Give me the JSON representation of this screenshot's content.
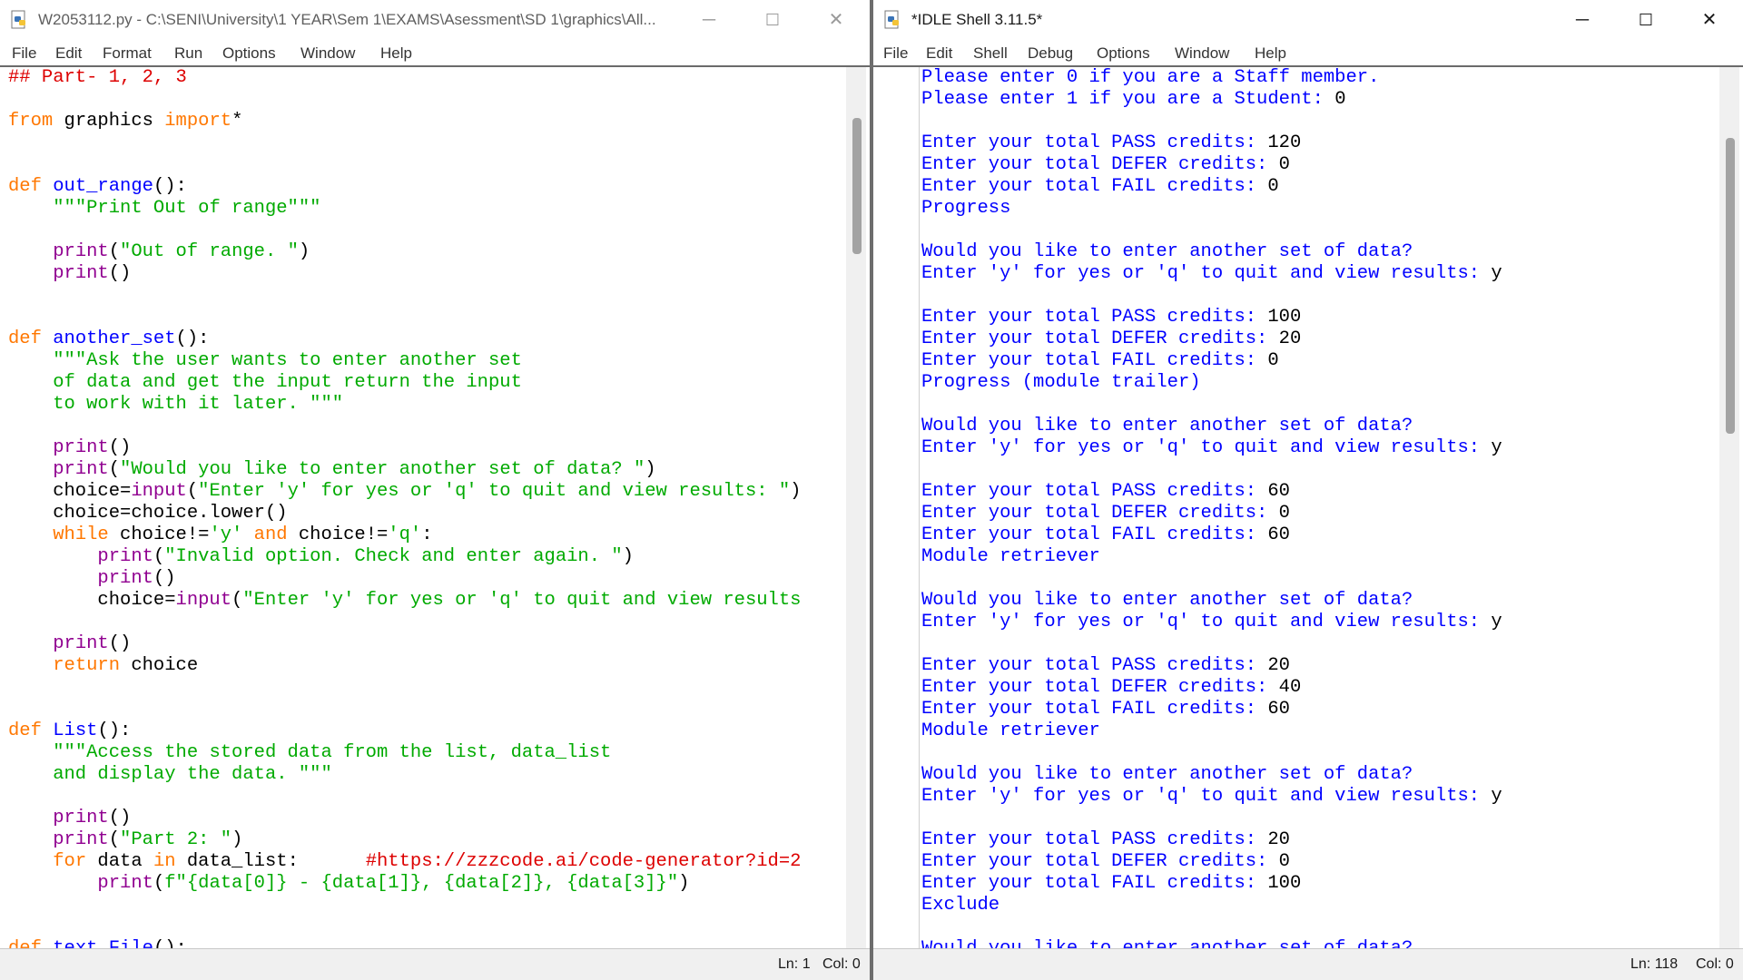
{
  "editor": {
    "title": "W2053112.py - C:\\SENI\\University\\1 YEAR\\Sem 1\\EXAMS\\Asessment\\SD 1\\graphics\\All...",
    "menu": [
      "File",
      "Edit",
      "Format",
      "Run",
      "Options",
      "Window",
      "Help"
    ],
    "status_ln": "Ln: 1",
    "status_col": "Col: 0",
    "code": [
      [
        [
          "c",
          "## Part- 1, 2, 3"
        ]
      ],
      [],
      [
        [
          "k",
          "from"
        ],
        [
          "n",
          " graphics "
        ],
        [
          "k",
          "import"
        ],
        [
          "n",
          "*"
        ]
      ],
      [],
      [],
      [
        [
          "k",
          "def"
        ],
        [
          "n",
          " "
        ],
        [
          "d",
          "out_range"
        ],
        [
          "n",
          "():"
        ]
      ],
      [
        [
          "n",
          "    "
        ],
        [
          "s",
          "\"\"\"Print Out of range\"\"\""
        ]
      ],
      [],
      [
        [
          "n",
          "    "
        ],
        [
          "b",
          "print"
        ],
        [
          "n",
          "("
        ],
        [
          "s",
          "\"Out of range. \""
        ],
        [
          "n",
          ")"
        ]
      ],
      [
        [
          "n",
          "    "
        ],
        [
          "b",
          "print"
        ],
        [
          "n",
          "()"
        ]
      ],
      [],
      [],
      [
        [
          "k",
          "def"
        ],
        [
          "n",
          " "
        ],
        [
          "d",
          "another_set"
        ],
        [
          "n",
          "():"
        ]
      ],
      [
        [
          "n",
          "    "
        ],
        [
          "s",
          "\"\"\"Ask the user wants to enter another set"
        ]
      ],
      [
        [
          "s",
          "    of data and get the input return the input"
        ]
      ],
      [
        [
          "s",
          "    to work with it later. \"\"\""
        ]
      ],
      [],
      [
        [
          "n",
          "    "
        ],
        [
          "b",
          "print"
        ],
        [
          "n",
          "()"
        ]
      ],
      [
        [
          "n",
          "    "
        ],
        [
          "b",
          "print"
        ],
        [
          "n",
          "("
        ],
        [
          "s",
          "\"Would you like to enter another set of data? \""
        ],
        [
          "n",
          ")"
        ]
      ],
      [
        [
          "n",
          "    choice="
        ],
        [
          "b",
          "input"
        ],
        [
          "n",
          "("
        ],
        [
          "s",
          "\"Enter 'y' for yes or 'q' to quit and view results: \""
        ],
        [
          "n",
          ")"
        ]
      ],
      [
        [
          "n",
          "    choice=choice.lower()"
        ]
      ],
      [
        [
          "n",
          "    "
        ],
        [
          "k",
          "while"
        ],
        [
          "n",
          " choice!="
        ],
        [
          "s",
          "'y'"
        ],
        [
          "n",
          " "
        ],
        [
          "k",
          "and"
        ],
        [
          "n",
          " choice!="
        ],
        [
          "s",
          "'q'"
        ],
        [
          "n",
          ":"
        ]
      ],
      [
        [
          "n",
          "        "
        ],
        [
          "b",
          "print"
        ],
        [
          "n",
          "("
        ],
        [
          "s",
          "\"Invalid option. Check and enter again. \""
        ],
        [
          "n",
          ")"
        ]
      ],
      [
        [
          "n",
          "        "
        ],
        [
          "b",
          "print"
        ],
        [
          "n",
          "()"
        ]
      ],
      [
        [
          "n",
          "        choice="
        ],
        [
          "b",
          "input"
        ],
        [
          "n",
          "("
        ],
        [
          "s",
          "\"Enter 'y' for yes or 'q' to quit and view results"
        ]
      ],
      [],
      [
        [
          "n",
          "    "
        ],
        [
          "b",
          "print"
        ],
        [
          "n",
          "()"
        ]
      ],
      [
        [
          "n",
          "    "
        ],
        [
          "k",
          "return"
        ],
        [
          "n",
          " choice"
        ]
      ],
      [],
      [],
      [
        [
          "k",
          "def"
        ],
        [
          "n",
          " "
        ],
        [
          "d",
          "List"
        ],
        [
          "n",
          "():"
        ]
      ],
      [
        [
          "n",
          "    "
        ],
        [
          "s",
          "\"\"\"Access the stored data from the list, data_list"
        ]
      ],
      [
        [
          "s",
          "    and display the data. \"\"\""
        ]
      ],
      [],
      [
        [
          "n",
          "    "
        ],
        [
          "b",
          "print"
        ],
        [
          "n",
          "()"
        ]
      ],
      [
        [
          "n",
          "    "
        ],
        [
          "b",
          "print"
        ],
        [
          "n",
          "("
        ],
        [
          "s",
          "\"Part 2: \""
        ],
        [
          "n",
          ")"
        ]
      ],
      [
        [
          "n",
          "    "
        ],
        [
          "k",
          "for"
        ],
        [
          "n",
          " data "
        ],
        [
          "k",
          "in"
        ],
        [
          "n",
          " data_list:      "
        ],
        [
          "c",
          "#https://zzzcode.ai/code-generator?id=2"
        ]
      ],
      [
        [
          "n",
          "        "
        ],
        [
          "b",
          "print"
        ],
        [
          "n",
          "("
        ],
        [
          "s",
          "f\"{data[0]} - {data[1]}, {data[2]}, {data[3]}\""
        ],
        [
          "n",
          ")"
        ]
      ],
      [],
      [],
      [
        [
          "k",
          "def"
        ],
        [
          "n",
          " "
        ],
        [
          "d",
          "text_File"
        ],
        [
          "n",
          "():"
        ]
      ]
    ]
  },
  "shell": {
    "title": "*IDLE Shell 3.11.5*",
    "menu": [
      "File",
      "Edit",
      "Shell",
      "Debug",
      "Options",
      "Window",
      "Help"
    ],
    "status_ln": "Ln: 118",
    "status_col": "Col: 0",
    "lines": [
      [
        [
          "o",
          "Please enter 0 if you are a Staff member."
        ]
      ],
      [
        [
          "o",
          "Please enter 1 if you are a Student: "
        ],
        [
          "i",
          "0"
        ]
      ],
      [],
      [
        [
          "o",
          "Enter your total PASS credits: "
        ],
        [
          "i",
          "120"
        ]
      ],
      [
        [
          "o",
          "Enter your total DEFER credits: "
        ],
        [
          "i",
          "0"
        ]
      ],
      [
        [
          "o",
          "Enter your total FAIL credits: "
        ],
        [
          "i",
          "0"
        ]
      ],
      [
        [
          "o",
          "Progress"
        ]
      ],
      [],
      [
        [
          "o",
          "Would you like to enter another set of data?"
        ]
      ],
      [
        [
          "o",
          "Enter 'y' for yes or 'q' to quit and view results: "
        ],
        [
          "i",
          "y"
        ]
      ],
      [],
      [
        [
          "o",
          "Enter your total PASS credits: "
        ],
        [
          "i",
          "100"
        ]
      ],
      [
        [
          "o",
          "Enter your total DEFER credits: "
        ],
        [
          "i",
          "20"
        ]
      ],
      [
        [
          "o",
          "Enter your total FAIL credits: "
        ],
        [
          "i",
          "0"
        ]
      ],
      [
        [
          "o",
          "Progress (module trailer)"
        ]
      ],
      [],
      [
        [
          "o",
          "Would you like to enter another set of data?"
        ]
      ],
      [
        [
          "o",
          "Enter 'y' for yes or 'q' to quit and view results: "
        ],
        [
          "i",
          "y"
        ]
      ],
      [],
      [
        [
          "o",
          "Enter your total PASS credits: "
        ],
        [
          "i",
          "60"
        ]
      ],
      [
        [
          "o",
          "Enter your total DEFER credits: "
        ],
        [
          "i",
          "0"
        ]
      ],
      [
        [
          "o",
          "Enter your total FAIL credits: "
        ],
        [
          "i",
          "60"
        ]
      ],
      [
        [
          "o",
          "Module retriever"
        ]
      ],
      [],
      [
        [
          "o",
          "Would you like to enter another set of data?"
        ]
      ],
      [
        [
          "o",
          "Enter 'y' for yes or 'q' to quit and view results: "
        ],
        [
          "i",
          "y"
        ]
      ],
      [],
      [
        [
          "o",
          "Enter your total PASS credits: "
        ],
        [
          "i",
          "20"
        ]
      ],
      [
        [
          "o",
          "Enter your total DEFER credits: "
        ],
        [
          "i",
          "40"
        ]
      ],
      [
        [
          "o",
          "Enter your total FAIL credits: "
        ],
        [
          "i",
          "60"
        ]
      ],
      [
        [
          "o",
          "Module retriever"
        ]
      ],
      [],
      [
        [
          "o",
          "Would you like to enter another set of data?"
        ]
      ],
      [
        [
          "o",
          "Enter 'y' for yes or 'q' to quit and view results: "
        ],
        [
          "i",
          "y"
        ]
      ],
      [],
      [
        [
          "o",
          "Enter your total PASS credits: "
        ],
        [
          "i",
          "20"
        ]
      ],
      [
        [
          "o",
          "Enter your total DEFER credits: "
        ],
        [
          "i",
          "0"
        ]
      ],
      [
        [
          "o",
          "Enter your total FAIL credits: "
        ],
        [
          "i",
          "100"
        ]
      ],
      [
        [
          "o",
          "Exclude"
        ]
      ],
      [],
      [
        [
          "o",
          "Would you like to enter another set of data?"
        ]
      ]
    ]
  },
  "icons": {
    "minimize": "─",
    "maximize": "☐",
    "close": "✕"
  }
}
